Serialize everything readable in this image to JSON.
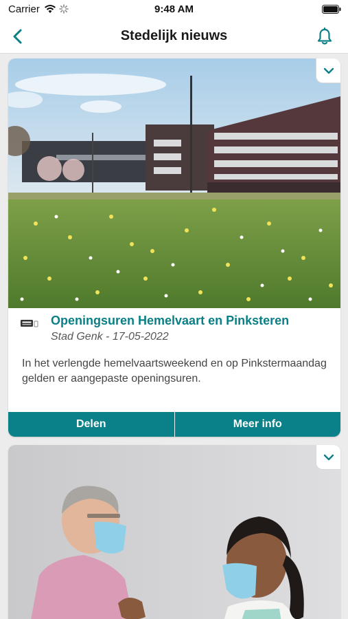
{
  "status": {
    "carrier": "Carrier",
    "time": "9:48 AM"
  },
  "nav": {
    "title": "Stedelijk nieuws",
    "back_icon": "chevron-left-icon",
    "bell_icon": "bell-icon",
    "accent_color": "#0a7f86"
  },
  "feed": {
    "items": [
      {
        "title": "Openingsuren Hemelvaart en Pinksteren",
        "meta": "Stad Genk - 17-05-2022",
        "body": "In het verlengde hemelvaartsweekend en op Pinkstermaandag gelden er aangepaste openingsuren.",
        "image": "city-building-with-daffodil-field",
        "actions": {
          "share_label": "Delen",
          "more_label": "Meer info"
        }
      },
      {
        "image": "vaccination-nurse-and-senior-man-with-masks"
      }
    ]
  }
}
